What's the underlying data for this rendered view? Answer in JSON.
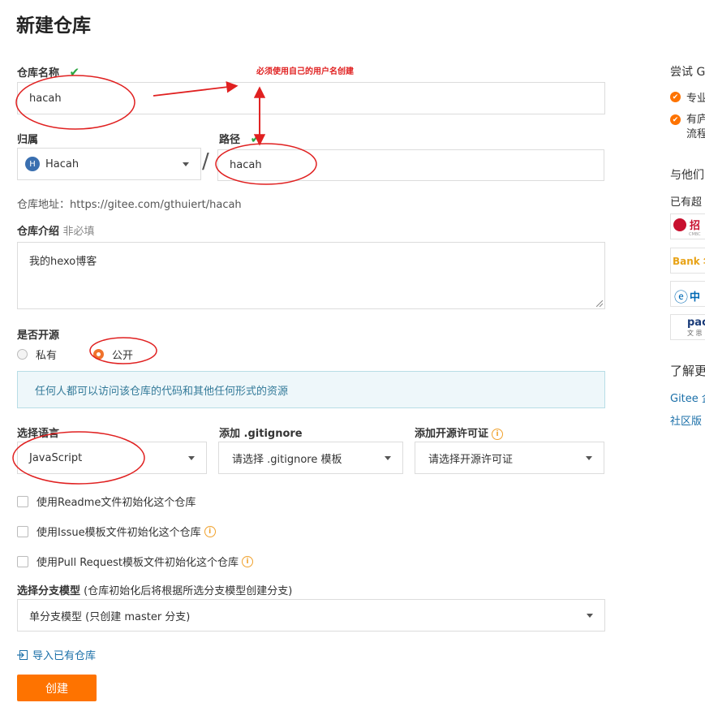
{
  "page": {
    "title": "新建仓库"
  },
  "form": {
    "repo_name_label": "仓库名称",
    "repo_name_value": "hacah",
    "owner_label": "归属",
    "owner_value": "Hacah",
    "owner_avatar_letter": "H",
    "path_label": "路径",
    "path_separator": "/",
    "path_value": "hacah",
    "repo_address_label": "仓库地址：",
    "repo_address_value": "https://gitee.com/gthuiert/hacah",
    "intro_label": "仓库介绍",
    "intro_optional": "非必填",
    "intro_value": "我的hexo博客",
    "open_source_label": "是否开源",
    "private_label": "私有",
    "public_label": "公开",
    "public_notice": "任何人都可以访问该仓库的代码和其他任何形式的资源",
    "language_label": "选择语言",
    "language_value": "JavaScript",
    "gitignore_label": "添加 .gitignore",
    "gitignore_placeholder": "请选择 .gitignore 模板",
    "license_label": "添加开源许可证",
    "license_placeholder": "请选择开源许可证",
    "readme_label": "使用Readme文件初始化这个仓库",
    "issue_label": "使用Issue模板文件初始化这个仓库",
    "pr_label": "使用Pull Request模板文件初始化这个仓库",
    "branch_model_label": "选择分支模型",
    "branch_model_hint": "(仓库初始化后将根据所选分支模型创建分支)",
    "branch_model_value": "单分支模型 (只创建 master 分支)",
    "import_link": "导入已有仓库",
    "create_button": "创建"
  },
  "annotation": {
    "note": "必须使用自己的用户名创建",
    "color": "#e02020"
  },
  "sidebar": {
    "try_title": "尝试 G",
    "feature_1": "专业",
    "feature_2_line1": "有庐",
    "feature_2_line2": "流程",
    "partners_title": "与他们",
    "partners_sub": "已有超",
    "logos": [
      {
        "text": "招",
        "color": "#c8102e"
      },
      {
        "text": "Bank 华",
        "color": "#e8a317"
      },
      {
        "text": "中",
        "color": "#0069b4"
      },
      {
        "text": "pac",
        "color": "#1c3d7a"
      }
    ],
    "logo_subtexts": [
      "CMBC",
      "文 思"
    ],
    "learn_more": "了解更",
    "link_1": "Gitee 企",
    "link_2": "社区版"
  },
  "colors": {
    "accent": "#fe7300",
    "check": "#2aa640",
    "notice_bg": "#eef7fa"
  }
}
